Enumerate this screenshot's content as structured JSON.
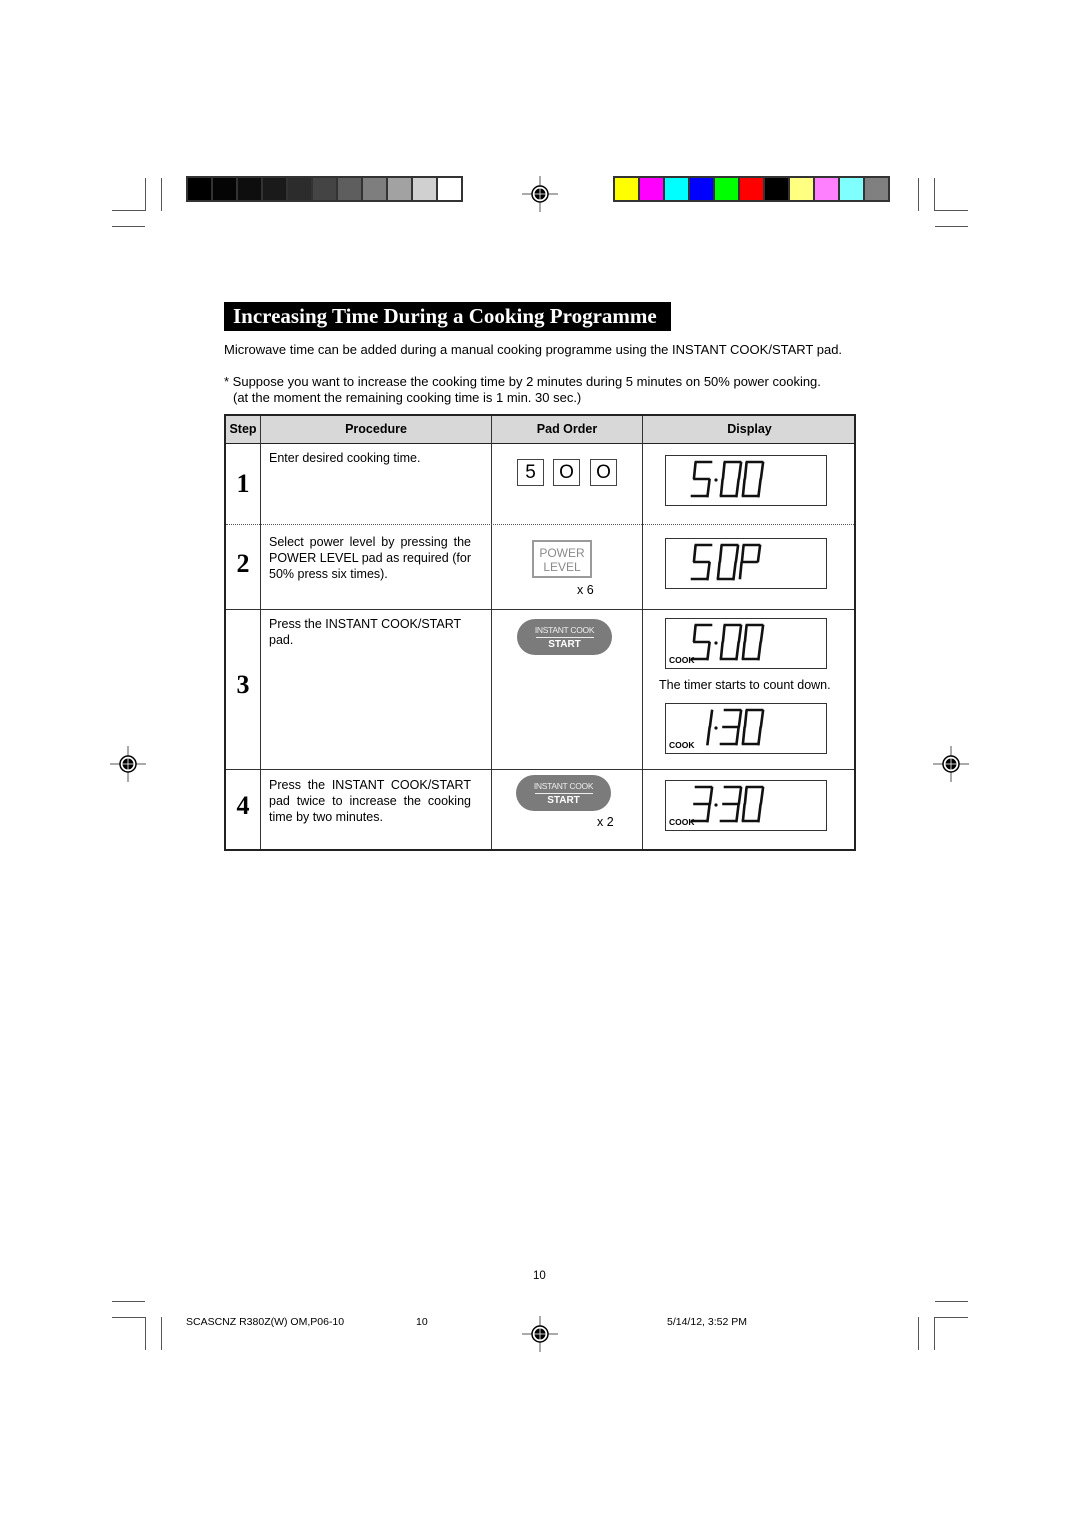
{
  "color_bars": {
    "grayscale": [
      "#000000",
      "#050505",
      "#0e0e0e",
      "#1a1a1a",
      "#2c2c2c",
      "#444444",
      "#5e5e5e",
      "#7e7e7e",
      "#a2a2a2",
      "#d0d0d0",
      "#ffffff"
    ],
    "process": [
      "#ffff00",
      "#ff00ff",
      "#00ffff",
      "#0000ff",
      "#00ff00",
      "#ff0000",
      "#000000",
      "#ffff80",
      "#ff80ff",
      "#80ffff",
      "#808080"
    ]
  },
  "title": "Increasing Time During a Cooking Programme",
  "intro": {
    "line1": "Microwave time can be added during a manual cooking programme using the INSTANT COOK/START pad.",
    "line2": "* Suppose you want to increase the cooking time by 2 minutes during 5 minutes on 50% power cooking.",
    "line3": "(at the moment the remaining cooking time is 1 min. 30 sec.)"
  },
  "table": {
    "headers": {
      "step": "Step",
      "procedure": "Procedure",
      "pad_order": "Pad Order",
      "display": "Display"
    },
    "rows": [
      {
        "step": "1",
        "procedure": "Enter desired cooking time.",
        "pads": [
          "5",
          "O",
          "O"
        ],
        "display": {
          "value": "5.00",
          "indicator": ""
        }
      },
      {
        "step": "2",
        "procedure": "Select power level by pressing the POWER LEVEL pad as required (for 50% press six times).",
        "pad": {
          "line1": "POWER",
          "line2": "LEVEL"
        },
        "times": "x 6",
        "display": {
          "value": "50P",
          "indicator": ""
        }
      },
      {
        "step": "3",
        "procedure": "Press the INSTANT COOK/START pad.",
        "pad": {
          "line1": "INSTANT COOK",
          "line2": "START"
        },
        "display": {
          "value": "5.00",
          "indicator": "COOK"
        },
        "note": "The timer starts to count down.",
        "display2": {
          "value": "1.30",
          "indicator": "COOK"
        }
      },
      {
        "step": "4",
        "procedure": "Press the INSTANT COOK/START pad twice to increase the cooking time by two minutes.",
        "pad": {
          "line1": "INSTANT COOK",
          "line2": "START"
        },
        "times": "x 2",
        "display": {
          "value": "3.30",
          "indicator": "COOK"
        }
      }
    ]
  },
  "page_number": "10",
  "footer": {
    "file": "SCASCNZ R380Z(W) OM,P06-10",
    "page": "10",
    "timestamp": "5/14/12, 3:52 PM"
  }
}
